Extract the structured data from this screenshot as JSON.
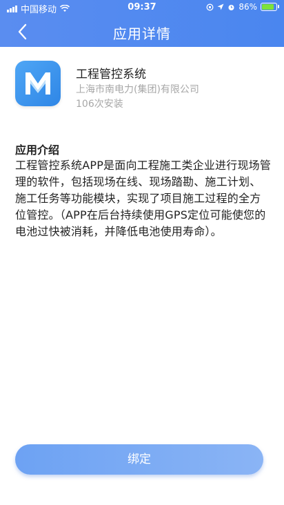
{
  "status_bar": {
    "carrier": "中国移动",
    "time": "09:37",
    "battery": "86%",
    "battery_level": 0.86
  },
  "nav": {
    "title": "应用详情",
    "back_icon": "chevron-left-icon"
  },
  "app": {
    "icon_letter": "M",
    "name": "工程管控系统",
    "company": "上海市南电力(集团)有限公司",
    "installs": "106次安装"
  },
  "intro": {
    "title": "应用介绍",
    "text": "工程管控系统APP是面向工程施工类企业进行现场管理的软件，包括现场在线、现场踏勘、施工计划、施工任务等功能模块，实现了项目施工过程的全方位管控。（APP在后台持续使用GPS定位可能使您的电池过快被消耗，并降低电池使用寿命）。"
  },
  "actions": {
    "bind_label": "绑定"
  },
  "colors": {
    "header": "#4a86ef",
    "button": "#7aabf4",
    "muted_text": "#a7a7a7"
  }
}
